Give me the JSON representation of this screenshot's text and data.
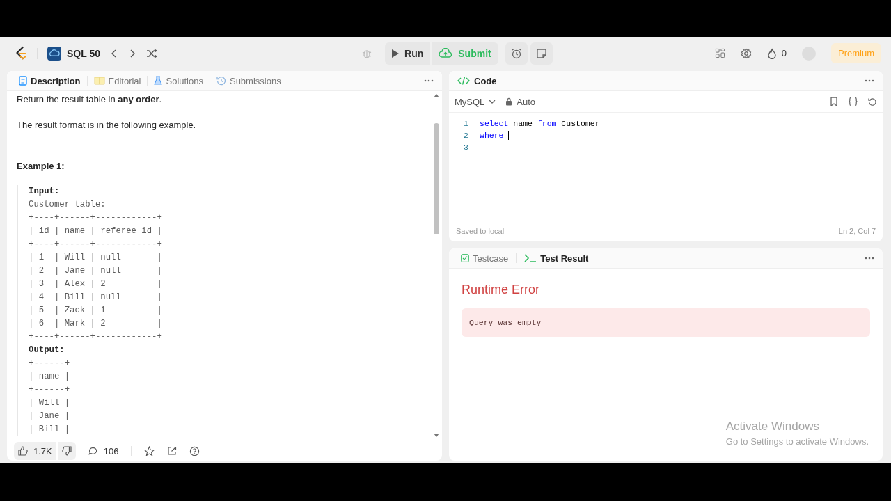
{
  "top_bar": {
    "title": "SQL 50",
    "run": "Run",
    "submit": "Submit",
    "streak": "0",
    "premium": "Premium"
  },
  "description_tabs": [
    {
      "label": "Description",
      "selected": true
    },
    {
      "label": "Editorial",
      "selected": false
    },
    {
      "label": "Solutions",
      "selected": false
    },
    {
      "label": "Submissions",
      "selected": false
    }
  ],
  "description": {
    "paragraphs": [
      "Return the result table in **any order**.",
      "The result format is in the following example."
    ],
    "example_title": "Example 1:",
    "example_lines": [
      {
        "kind": "label",
        "text": "Input:"
      },
      {
        "kind": "text",
        "text": "Customer table:"
      },
      {
        "kind": "text",
        "text": "+----+------+------------+"
      },
      {
        "kind": "text",
        "text": "| id | name | referee_id |"
      },
      {
        "kind": "text",
        "text": "+----+------+------------+"
      },
      {
        "kind": "text",
        "text": "| 1  | Will | null       |"
      },
      {
        "kind": "text",
        "text": "| 2  | Jane | null       |"
      },
      {
        "kind": "text",
        "text": "| 3  | Alex | 2          |"
      },
      {
        "kind": "text",
        "text": "| 4  | Bill | null       |"
      },
      {
        "kind": "text",
        "text": "| 5  | Zack | 1          |"
      },
      {
        "kind": "text",
        "text": "| 6  | Mark | 2          |"
      },
      {
        "kind": "text",
        "text": "+----+------+------------+"
      },
      {
        "kind": "label",
        "text": "Output:"
      },
      {
        "kind": "text",
        "text": "+------+"
      },
      {
        "kind": "text",
        "text": "| name |"
      },
      {
        "kind": "text",
        "text": "+------+"
      },
      {
        "kind": "text",
        "text": "| Will |"
      },
      {
        "kind": "text",
        "text": "| Jane |"
      },
      {
        "kind": "text",
        "text": "| Bill |"
      }
    ]
  },
  "description_footer": {
    "likes": "1.7K",
    "comments": "106"
  },
  "code_panel": {
    "title": "Code",
    "language": "MySQL",
    "mode": "Auto",
    "lines": [
      {
        "number": "1",
        "tokens": [
          {
            "kind": "keyword",
            "text": "select"
          },
          {
            "kind": "plain",
            "text": " name "
          },
          {
            "kind": "keyword",
            "text": "from"
          },
          {
            "kind": "plain",
            "text": " Customer"
          }
        ]
      },
      {
        "number": "2",
        "tokens": [
          {
            "kind": "keyword",
            "text": "where"
          }
        ]
      },
      {
        "number": "3"
      }
    ],
    "status": "Saved to local",
    "cursor_position": "Ln 2, Col 7"
  },
  "result_tabs": [
    {
      "label": "Testcase",
      "selected": false
    },
    {
      "label": "Test Result",
      "selected": true
    }
  ],
  "result": {
    "title": "Runtime Error",
    "message": "Query was empty"
  },
  "os_notice": {
    "title": "Activate Windows",
    "subtitle": "Go to Settings to activate Windows."
  }
}
